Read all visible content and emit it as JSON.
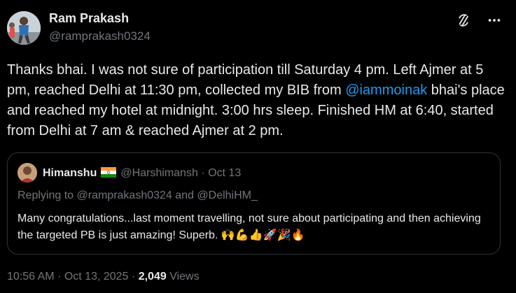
{
  "author": {
    "name": "Ram Prakash",
    "handle": "@ramprakash0324"
  },
  "tweet": {
    "text_before_mention": "Thanks bhai. I was not sure of participation till Saturday 4 pm. Left Ajmer at 5 pm, reached Delhi at 11:30 pm, collected my BIB from ",
    "mention": "@iammoinak",
    "text_after_mention": " bhai's place and reached my hotel at midnight. 3:00 hrs sleep. Finished HM at 6:40, started from Delhi at 7 am & reached Ajmer at 2 pm."
  },
  "quote": {
    "name": "Himanshu",
    "flag_icon": "india-flag-icon",
    "handle": "@Harshimansh",
    "separator": "·",
    "date": "Oct 13",
    "replying_to": "Replying to @ramprakash0324 and @DelhiHM_",
    "text": "Many congratulations...last moment travelling, not sure about participating and then achieving the targeted PB is just amazing! Superb. 🙌💪👍🚀🎉🔥"
  },
  "meta": {
    "time": "10:56 AM",
    "separator": "·",
    "date": "Oct 13, 2025",
    "separator2": "·",
    "views_count": "2,049",
    "views_label": "Views"
  },
  "icons": {
    "grok": "grok-icon",
    "more": "more-icon"
  },
  "colors": {
    "background": "#000000",
    "text": "#e7e9ea",
    "secondary": "#71767b",
    "link": "#1d9bf0",
    "border": "#2f3336"
  }
}
